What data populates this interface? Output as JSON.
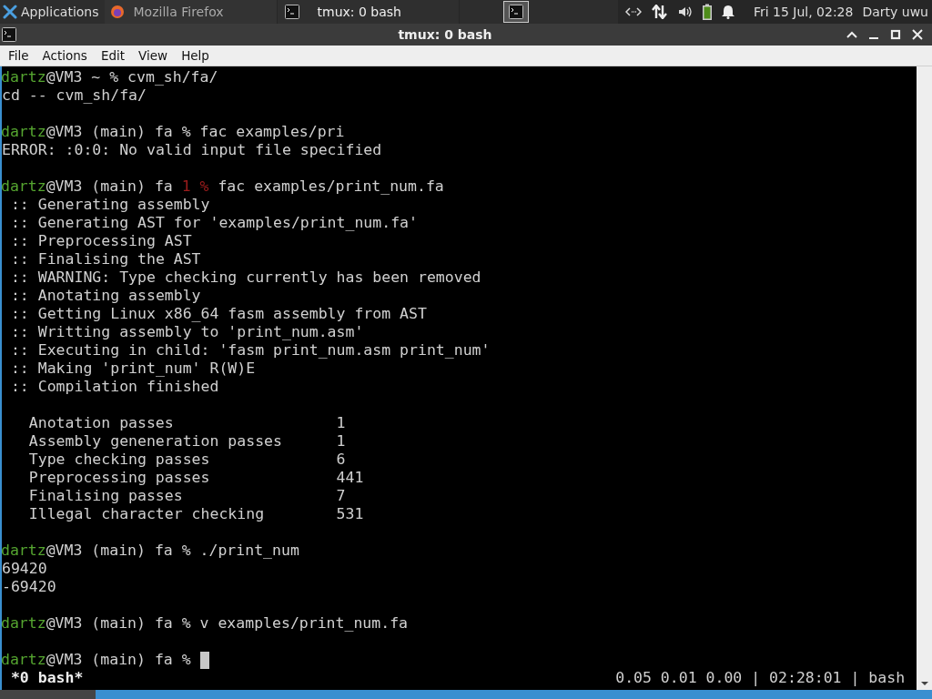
{
  "panel": {
    "menu_label": "Applications",
    "tasks": [
      {
        "title": "Mozilla Firefox",
        "kind": "firefox",
        "selected": false
      },
      {
        "title": "tmux: 0 bash",
        "kind": "terminal",
        "selected": true
      }
    ],
    "clock": "Fri 15 Jul, 02:28",
    "user": "Darty uwu"
  },
  "window": {
    "title": "tmux: 0 bash"
  },
  "menu": [
    "File",
    "Actions",
    "Edit",
    "View",
    "Help"
  ],
  "terminal": {
    "lines": [
      {
        "kind": "prompt",
        "segments": [
          {
            "kind": "user",
            "text": "dartz"
          },
          {
            "kind": "plain",
            "text": "@VM3 ~ % cvm_sh/fa/"
          }
        ]
      },
      {
        "kind": "output",
        "text": "cd -- cvm_sh/fa/"
      },
      {
        "kind": "blank"
      },
      {
        "kind": "prompt",
        "segments": [
          {
            "kind": "user",
            "text": "dartz"
          },
          {
            "kind": "plain",
            "text": "@VM3 (main) fa % fac examples/pri"
          }
        ]
      },
      {
        "kind": "output",
        "text": "ERROR: :0:0: No valid input file specified"
      },
      {
        "kind": "blank"
      },
      {
        "kind": "prompt",
        "segments": [
          {
            "kind": "user",
            "text": "dartz"
          },
          {
            "kind": "plain",
            "text": "@VM3 (main) fa "
          },
          {
            "kind": "error",
            "text": "1 %"
          },
          {
            "kind": "plain",
            "text": " fac examples/print_num.fa"
          }
        ]
      },
      {
        "kind": "output",
        "text": " :: Generating assembly"
      },
      {
        "kind": "output",
        "text": " :: Generating AST for 'examples/print_num.fa'"
      },
      {
        "kind": "output",
        "text": " :: Preprocessing AST"
      },
      {
        "kind": "output",
        "text": " :: Finalising the AST"
      },
      {
        "kind": "output",
        "text": " :: WARNING: Type checking currently has been removed"
      },
      {
        "kind": "output",
        "text": " :: Anotating assembly"
      },
      {
        "kind": "output",
        "text": " :: Getting Linux x86_64 fasm assembly from AST"
      },
      {
        "kind": "output",
        "text": " :: Writting assembly to 'print_num.asm'"
      },
      {
        "kind": "output",
        "text": " :: Executing in child: 'fasm print_num.asm print_num'"
      },
      {
        "kind": "output",
        "text": " :: Making 'print_num' R(W)E"
      },
      {
        "kind": "output",
        "text": " :: Compilation finished"
      },
      {
        "kind": "blank"
      },
      {
        "kind": "stat",
        "label": "Anotation passes",
        "value": "1"
      },
      {
        "kind": "stat",
        "label": "Assembly geneneration passes",
        "value": "1"
      },
      {
        "kind": "stat",
        "label": "Type checking passes",
        "value": "6"
      },
      {
        "kind": "stat",
        "label": "Preprocessing passes",
        "value": "441"
      },
      {
        "kind": "stat",
        "label": "Finalising passes",
        "value": "7"
      },
      {
        "kind": "stat",
        "label": "Illegal character checking",
        "value": "531"
      },
      {
        "kind": "blank"
      },
      {
        "kind": "prompt",
        "segments": [
          {
            "kind": "user",
            "text": "dartz"
          },
          {
            "kind": "plain",
            "text": "@VM3 (main) fa % ./print_num"
          }
        ]
      },
      {
        "kind": "output",
        "text": "69420"
      },
      {
        "kind": "output",
        "text": "-69420"
      },
      {
        "kind": "blank"
      },
      {
        "kind": "prompt",
        "segments": [
          {
            "kind": "user",
            "text": "dartz"
          },
          {
            "kind": "plain",
            "text": "@VM3 (main) fa % v examples/print_num.fa"
          }
        ]
      },
      {
        "kind": "blank"
      },
      {
        "kind": "prompt",
        "cursor": true,
        "segments": [
          {
            "kind": "user",
            "text": "dartz"
          },
          {
            "kind": "plain",
            "text": "@VM3 (main) fa % "
          }
        ]
      }
    ]
  },
  "tmux_status": {
    "window": "*0 bash*",
    "right": "0.05 0.01 0.00 | 02:28:01 | bash"
  }
}
